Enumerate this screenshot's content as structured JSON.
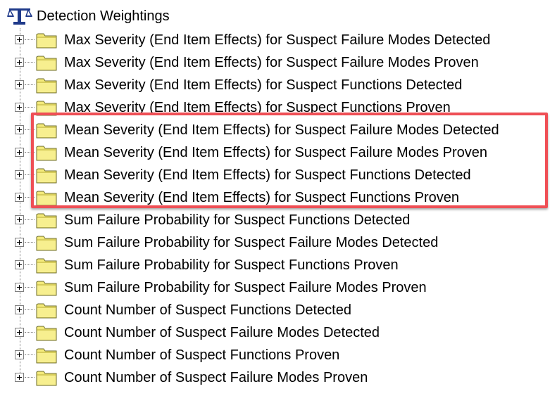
{
  "root": {
    "label": "Detection Weightings",
    "icon": "balance-scale-icon"
  },
  "items": [
    {
      "label": "Max Severity (End Item Effects) for Suspect Failure Modes Detected"
    },
    {
      "label": "Max Severity (End Item Effects) for Suspect Failure Modes Proven"
    },
    {
      "label": "Max Severity (End Item Effects) for Suspect Functions Detected"
    },
    {
      "label": "Max Severity (End Item Effects) for Suspect Functions Proven"
    },
    {
      "label": "Mean Severity (End Item Effects) for Suspect Failure Modes Detected"
    },
    {
      "label": "Mean Severity (End Item Effects) for Suspect Failure Modes Proven"
    },
    {
      "label": "Mean Severity (End Item Effects) for Suspect Functions Detected"
    },
    {
      "label": "Mean Severity (End Item Effects) for Suspect Functions Proven"
    },
    {
      "label": "Sum Failure Probability for Suspect Functions Detected"
    },
    {
      "label": "Sum Failure Probability for Suspect Failure Modes Detected"
    },
    {
      "label": "Sum Failure Probability for Suspect Functions Proven"
    },
    {
      "label": "Sum Failure Probability for Suspect Failure Modes Proven"
    },
    {
      "label": "Count Number of Suspect Functions Detected"
    },
    {
      "label": "Count Number of Suspect Failure Modes Detected"
    },
    {
      "label": "Count Number of Suspect Functions Proven"
    },
    {
      "label": "Count Number of Suspect Failure Modes Proven"
    }
  ],
  "icons": {
    "expander": "plus-box-icon",
    "folder": "folder-icon"
  },
  "colors": {
    "highlight": "#ef4f55",
    "folder_fill": "#f4ea7a",
    "root_icon": "#1f3a8a"
  }
}
